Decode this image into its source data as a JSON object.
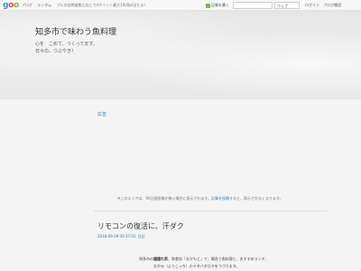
{
  "topbar": {
    "logo": "goo",
    "nav": [
      "ブログ",
      "ランダム"
    ],
    "promo": "ブルの訪問者数に応じてdポイント最大1000pt当たる！",
    "subscribe_label": "記事を書く",
    "search_scope": "ウェブ",
    "user_links": [
      "ログイン",
      "ブログ開設"
    ]
  },
  "header": {
    "title": "知多市で味わう魚料理",
    "tagline1": "心を　こめて、つくってます。",
    "tagline2": "日々の、つぶやき！"
  },
  "ad": {
    "label": "広告",
    "note_prefix": "※このエリアは、90日間投稿が無い場合に表示されます。",
    "note_link": "記事を投稿",
    "note_suffix": "すると、表示されなくなります。"
  },
  "post": {
    "title": "リモコンの復活に、汗ダク",
    "date": "2018-09-29 00:37:01",
    "category": "日記",
    "line1_prefix": "知多市の",
    "line1_bold": "鐘鐘れ家",
    "line1_suffix": "、和食処「おかもと」で、場合う魚料理と、おすすめランチ、",
    "line2": "おかみ（ようこっち）のドタバタ日々をつづります。"
  }
}
